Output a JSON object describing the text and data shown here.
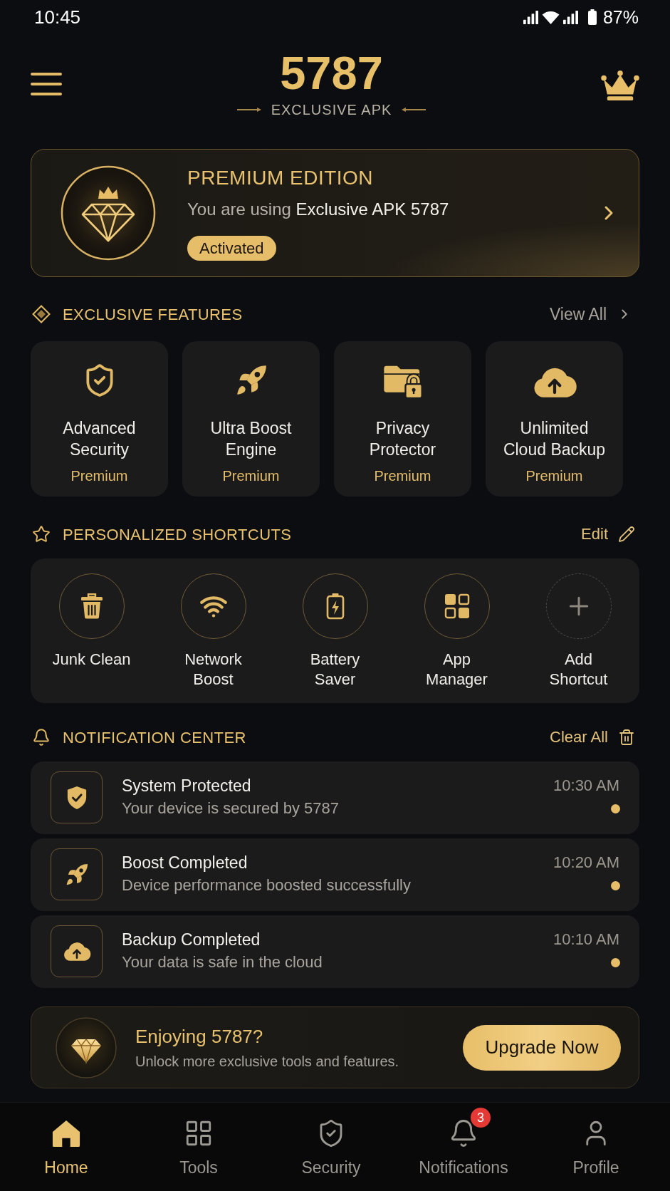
{
  "status_bar": {
    "time": "10:45",
    "battery": "87%"
  },
  "header": {
    "title": "5787",
    "subtitle": "EXCLUSIVE APK"
  },
  "premium_card": {
    "title": "PREMIUM EDITION",
    "description": "You are using",
    "description_highlight": "Exclusive APK 5787",
    "badge": "Activated"
  },
  "features": {
    "title": "EXCLUSIVE FEATURES",
    "link": "View All",
    "items": [
      {
        "name": "Advanced Security",
        "tag": "Premium"
      },
      {
        "name": "Ultra Boost Engine",
        "tag": "Premium"
      },
      {
        "name": "Privacy Protector",
        "tag": "Premium"
      },
      {
        "name": "Unlimited Cloud Backup",
        "tag": "Premium"
      }
    ]
  },
  "shortcuts": {
    "title": "PERSONALIZED SHORTCUTS",
    "action": "Edit",
    "items": [
      {
        "kind": "shortcut",
        "label": "Junk Clean"
      },
      {
        "kind": "shortcut",
        "label": "Network Boost"
      },
      {
        "kind": "shortcut",
        "label": "Battery Saver"
      },
      {
        "kind": "shortcut",
        "label": "App Manager"
      },
      {
        "kind": "add",
        "label": "Add Shortcut"
      }
    ]
  },
  "notifications": {
    "title": "NOTIFICATION CENTER",
    "action": "Clear All",
    "items": [
      {
        "title": "System Protected",
        "message": "Your device is secured by 5787",
        "time": "10:30 AM",
        "unread": true
      },
      {
        "title": "Boost Completed",
        "message": "Device performance boosted successfully",
        "time": "10:20 AM",
        "unread": true
      },
      {
        "title": "Backup Completed",
        "message": "Your data is safe in the cloud",
        "time": "10:10 AM",
        "unread": true
      }
    ]
  },
  "promo": {
    "title": "Enjoying 5787?",
    "text": "Unlock more exclusive tools and features.",
    "button": "Upgrade Now"
  },
  "nav": {
    "items": [
      {
        "label": "Home",
        "selected": true
      },
      {
        "label": "Tools",
        "selected": false
      },
      {
        "label": "Security",
        "selected": false
      },
      {
        "label": "Notifications",
        "selected": false,
        "badge": "3"
      },
      {
        "label": "Profile",
        "selected": false
      }
    ]
  }
}
